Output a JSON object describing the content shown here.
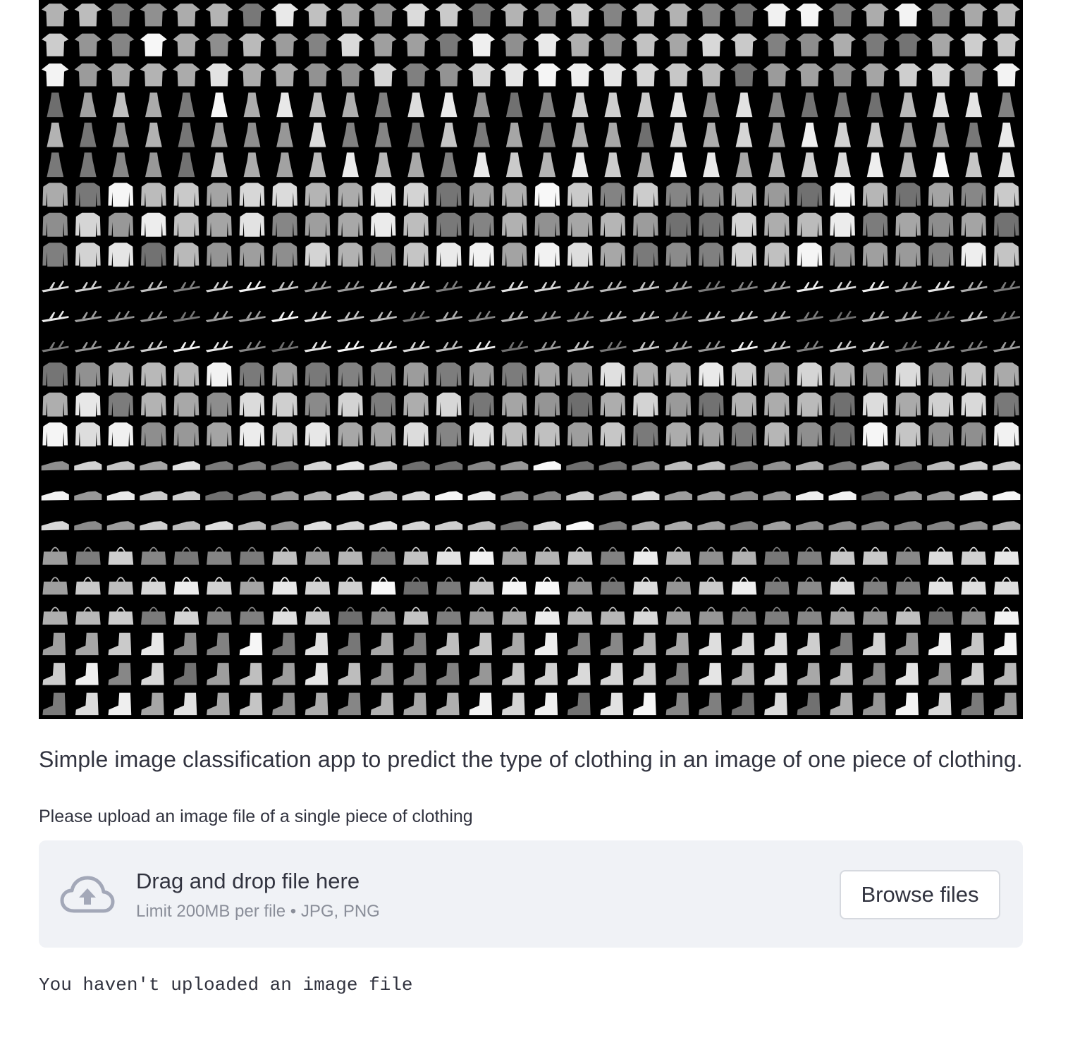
{
  "description": "Simple image classification app to predict the type of clothing in an image of one piece of clothing.",
  "uploader": {
    "label": "Please upload an image file of a single piece of clothing",
    "drop_title": "Drag and drop file here",
    "drop_limit": "Limit 200MB per file • JPG, PNG",
    "browse_label": "Browse files",
    "icon": "cloud-upload-icon"
  },
  "status": "You haven't uploaded an image file",
  "image": {
    "rows": [
      "t-shirt/top",
      "t-shirt/top",
      "t-shirt/top",
      "dress",
      "dress",
      "dress",
      "pullover",
      "pullover",
      "pullover",
      "sandal",
      "sandal",
      "sandal",
      "shirt",
      "shirt",
      "shirt",
      "sneaker",
      "sneaker",
      "sneaker",
      "bag",
      "bag",
      "bag",
      "ankle boot",
      "ankle boot",
      "ankle boot"
    ]
  },
  "colors": {
    "text": "#31333f",
    "muted": "#8a8e99",
    "dropzone_bg": "#f0f2f6",
    "icon": "#a3a8b8"
  }
}
